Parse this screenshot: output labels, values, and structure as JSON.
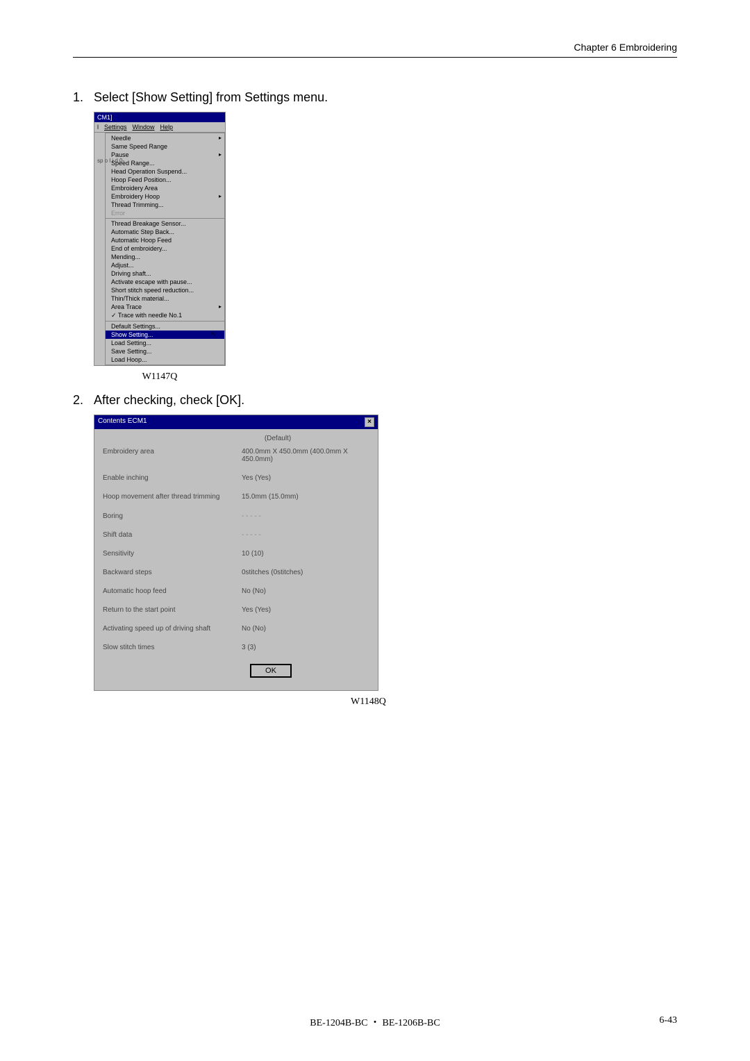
{
  "header": {
    "chapter": "Chapter 6    Embroidering"
  },
  "steps": [
    {
      "number": "1.",
      "text": "Select [Show Setting] from Settings menu."
    },
    {
      "number": "2.",
      "text": "After checking, check [OK]."
    }
  ],
  "screenshot1": {
    "title": "CM1]",
    "menubar": [
      "l",
      "Settings",
      "Window",
      "Help"
    ],
    "dropdown_items": [
      {
        "label": "Needle",
        "hasArrow": true
      },
      {
        "label": "Same Speed Range"
      },
      {
        "label": "Pause",
        "hasArrow": true
      },
      {
        "label": "Speed Range..."
      },
      {
        "label": "Head Operation Suspend..."
      },
      {
        "label": "Hoop Feed Position..."
      },
      {
        "label": "Embroidery Area"
      },
      {
        "label": "Embroidery Hoop",
        "hasArrow": true
      },
      {
        "label": "Thread Trimming..."
      },
      {
        "label": "Error",
        "disabled": true
      },
      {
        "separator": true
      },
      {
        "label": "Thread Breakage Sensor..."
      },
      {
        "label": "Automatic Step Back..."
      },
      {
        "label": "Automatic Hoop Feed"
      },
      {
        "label": "End of embroidery..."
      },
      {
        "label": "Mending..."
      },
      {
        "label": "Adjust..."
      },
      {
        "label": "Driving shaft..."
      },
      {
        "label": "Activate escape with pause..."
      },
      {
        "label": "Short stitch speed reduction..."
      },
      {
        "label": "Thin/Thick material..."
      },
      {
        "label": "Area Trace",
        "hasArrow": true
      },
      {
        "label": "✓ Trace with needle No.1"
      },
      {
        "separator": true
      },
      {
        "label": "Default Settings..."
      },
      {
        "label": "Show Setting...",
        "highlighted": true
      },
      {
        "label": "Load Setting..."
      },
      {
        "label": "Save Setting..."
      },
      {
        "label": "Load Hoop..."
      }
    ],
    "left_numbers": "sp\no\nl\ni\nd\n\n0-",
    "caption": "W1147Q"
  },
  "screenshot2": {
    "title": "Contents ECM1",
    "default_label": "(Default)",
    "rows": [
      {
        "label": "Embroidery area",
        "value": "400.0mm X 450.0mm  (400.0mm X 450.0mm)"
      },
      {
        "label": "Enable inching",
        "value": "Yes  (Yes)"
      },
      {
        "label": "Hoop movement after thread trimming",
        "value": "15.0mm  (15.0mm)"
      },
      {
        "label": "Boring",
        "value": "- - - - -"
      },
      {
        "label": "Shift data",
        "value": "- - - - -"
      },
      {
        "label": "Sensitivity",
        "value": "10  (10)"
      },
      {
        "label": "Backward steps",
        "value": "0stitches  (0stitches)"
      },
      {
        "label": "Automatic hoop feed",
        "value": "No  (No)"
      },
      {
        "label": "Return to the start point",
        "value": "Yes  (Yes)"
      },
      {
        "label": "Activating speed up of driving shaft",
        "value": "No  (No)"
      },
      {
        "label": "Slow stitch times",
        "value": "3  (3)"
      }
    ],
    "ok_button": "OK",
    "caption": "W1148Q"
  },
  "footer": {
    "center": "BE-1204B-BC ・ BE-1206B-BC",
    "right": "6-43"
  }
}
